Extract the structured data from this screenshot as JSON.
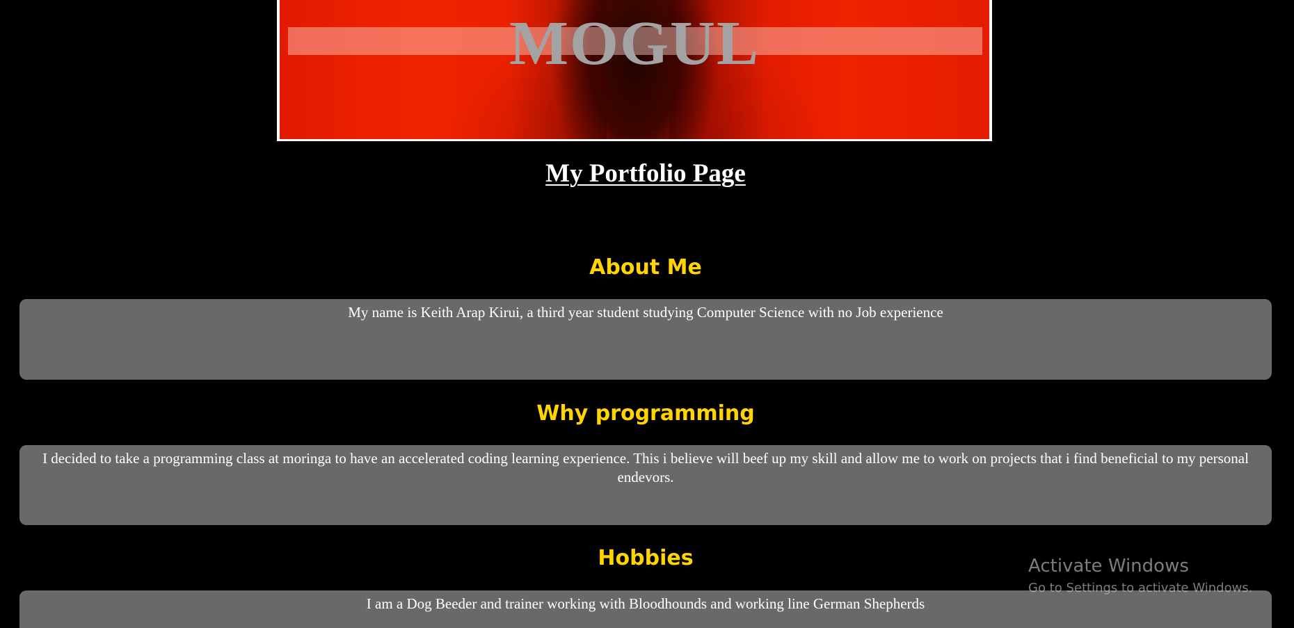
{
  "banner": {
    "title": "MOGUL"
  },
  "page": {
    "title": "My Portfolio Page"
  },
  "sections": [
    {
      "heading": "About Me",
      "text": "My name is Keith Arap Kirui, a third year student studying Computer Science with no Job experience"
    },
    {
      "heading": "Why programming",
      "text": "I decided to take a programming class at moringa to have an accelerated coding learning experience. This i believe will beef up my skill and allow me to work on projects that i find beneficial to my personal endevors."
    },
    {
      "heading": "Hobbies",
      "text": "I am a Dog Beeder and trainer working with Bloodhounds and working line German Shepherds"
    }
  ],
  "watermark": {
    "title": "Activate Windows",
    "subtitle": "Go to Settings to activate Windows."
  },
  "colors": {
    "background": "#000000",
    "heading": "#ffd400",
    "box": "#696969",
    "banner_red": "#e81e00"
  }
}
